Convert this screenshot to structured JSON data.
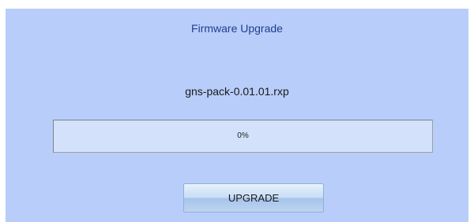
{
  "dialog": {
    "title": "Firmware Upgrade",
    "filename": "gns-pack-0.01.01.rxp"
  },
  "progress": {
    "value_percent": 0,
    "label": "0%"
  },
  "actions": {
    "upgrade_label": "UPGRADE"
  },
  "colors": {
    "panel_background": "#b8cdfa",
    "title_text": "#1f3f8f",
    "progress_fill": "#6f93e6"
  }
}
